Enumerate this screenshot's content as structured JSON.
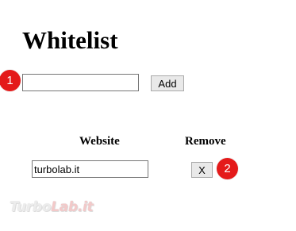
{
  "page": {
    "title": "Whitelist"
  },
  "add_form": {
    "input_value": "",
    "add_label": "Add"
  },
  "table": {
    "headers": {
      "website": "Website",
      "remove": "Remove"
    },
    "rows": [
      {
        "website": "turbolab.it",
        "remove_label": "X"
      }
    ]
  },
  "annotations": {
    "badge1": "1",
    "badge2": "2",
    "badge_color": "#e41a1a"
  },
  "watermark": {
    "text_a": "Turbo",
    "text_b": "Lab.it"
  }
}
